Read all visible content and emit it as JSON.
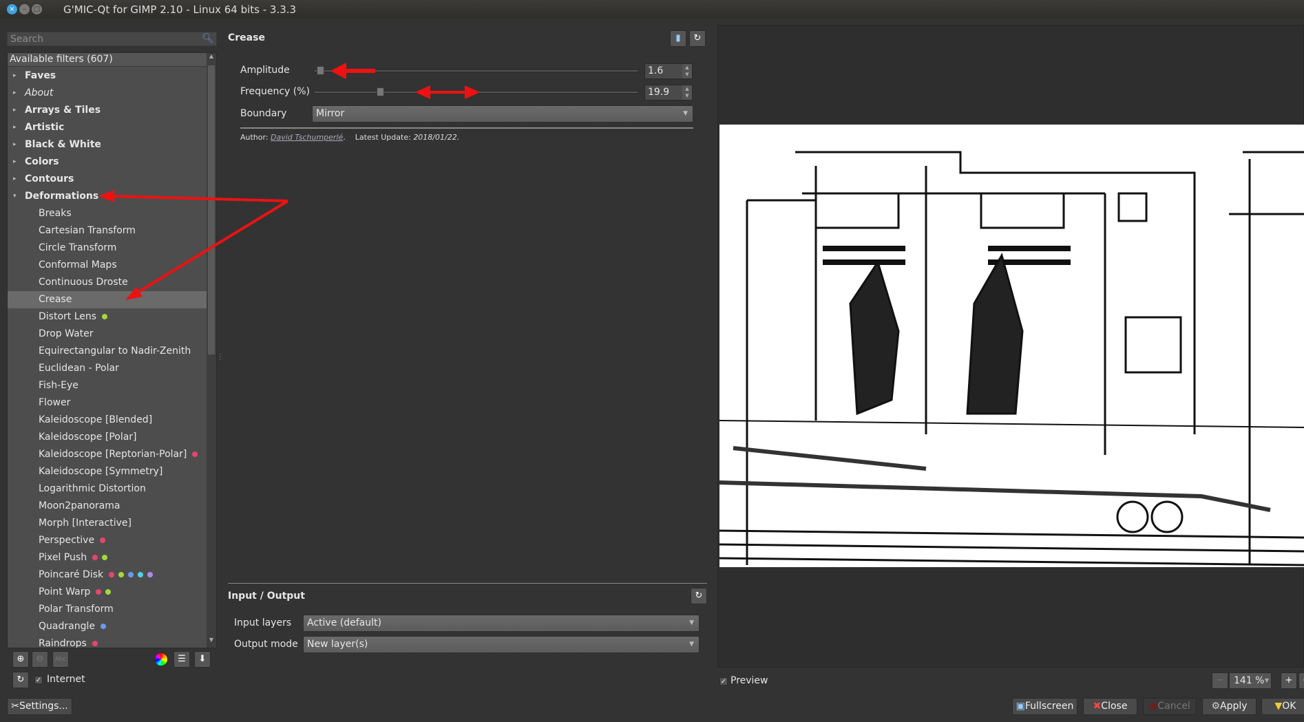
{
  "window": {
    "title": "G'MIC-Qt for GIMP 2.10 - Linux 64 bits - 3.3.3"
  },
  "search": {
    "placeholder": "Search"
  },
  "tree": {
    "header": "Available filters (607)",
    "rows": [
      {
        "label": "Faves",
        "type": "cat",
        "arrow": "▸"
      },
      {
        "label": "About",
        "type": "cat-italic",
        "arrow": "▸"
      },
      {
        "label": "Arrays & Tiles",
        "type": "cat",
        "arrow": "▸"
      },
      {
        "label": "Artistic",
        "type": "cat",
        "arrow": "▸"
      },
      {
        "label": "Black & White",
        "type": "cat",
        "arrow": "▸"
      },
      {
        "label": "Colors",
        "type": "cat",
        "arrow": "▸"
      },
      {
        "label": "Contours",
        "type": "cat",
        "arrow": "▸"
      },
      {
        "label": "Deformations",
        "type": "cat",
        "arrow": "▾"
      },
      {
        "label": "Breaks",
        "type": "it"
      },
      {
        "label": "Cartesian Transform",
        "type": "it"
      },
      {
        "label": "Circle Transform",
        "type": "it"
      },
      {
        "label": "Conformal Maps",
        "type": "it"
      },
      {
        "label": "Continuous Droste",
        "type": "it"
      },
      {
        "label": "Crease",
        "type": "it",
        "selected": true
      },
      {
        "label": "Distort Lens",
        "type": "it",
        "dots": [
          "#a6d83a"
        ]
      },
      {
        "label": "Drop Water",
        "type": "it"
      },
      {
        "label": "Equirectangular to Nadir-Zenith",
        "type": "it"
      },
      {
        "label": "Euclidean - Polar",
        "type": "it"
      },
      {
        "label": "Fish-Eye",
        "type": "it"
      },
      {
        "label": "Flower",
        "type": "it"
      },
      {
        "label": "Kaleidoscope [Blended]",
        "type": "it"
      },
      {
        "label": "Kaleidoscope [Polar]",
        "type": "it"
      },
      {
        "label": "Kaleidoscope [Reptorian-Polar]",
        "type": "it",
        "dots": [
          "#e8456e"
        ]
      },
      {
        "label": "Kaleidoscope [Symmetry]",
        "type": "it"
      },
      {
        "label": "Logarithmic Distortion",
        "type": "it"
      },
      {
        "label": "Moon2panorama",
        "type": "it"
      },
      {
        "label": "Morph [Interactive]",
        "type": "it"
      },
      {
        "label": "Perspective",
        "type": "it",
        "dots": [
          "#e8456e"
        ]
      },
      {
        "label": "Pixel Push",
        "type": "it",
        "dots": [
          "#e8456e",
          "#a6d83a"
        ]
      },
      {
        "label": "Poincaré Disk",
        "type": "it",
        "dots": [
          "#e8456e",
          "#a6d83a",
          "#6a9af0",
          "#4fd0e8",
          "#b08ae8"
        ]
      },
      {
        "label": "Point Warp",
        "type": "it",
        "dots": [
          "#e8456e",
          "#a6d83a"
        ]
      },
      {
        "label": "Polar Transform",
        "type": "it"
      },
      {
        "label": "Quadrangle",
        "type": "it",
        "dots": [
          "#6a9af0"
        ]
      },
      {
        "label": "Raindrops",
        "type": "it",
        "dots": [
          "#e8456e"
        ]
      }
    ]
  },
  "left_bottom": {
    "internet_label": "Internet",
    "internet_checked": true,
    "settings_label": "Settings..."
  },
  "filter": {
    "title": "Crease",
    "amplitude": {
      "label": "Amplitude",
      "value": "1.6",
      "fraction": 0.01
    },
    "frequency": {
      "label": "Frequency (%)",
      "value": "19.9",
      "fraction": 0.2
    },
    "boundary": {
      "label": "Boundary",
      "value": "Mirror"
    },
    "author_label": "Author:",
    "author": "David Tschumperlé",
    "author_suffix": ".",
    "update_label": "Latest Update:",
    "update": "2018/01/22."
  },
  "io": {
    "title": "Input / Output",
    "input_label": "Input layers",
    "input_value": "Active (default)",
    "output_label": "Output mode",
    "output_value": "New layer(s)"
  },
  "preview": {
    "label": "Preview",
    "checked": true,
    "zoom": "141 %"
  },
  "buttons": {
    "fullscreen": "Fullscreen",
    "close": "Close",
    "cancel": "Cancel",
    "apply": "Apply",
    "ok": "OK"
  },
  "colors": {
    "annotation": "#ee1111",
    "selected_row": "#6a6a6a"
  }
}
